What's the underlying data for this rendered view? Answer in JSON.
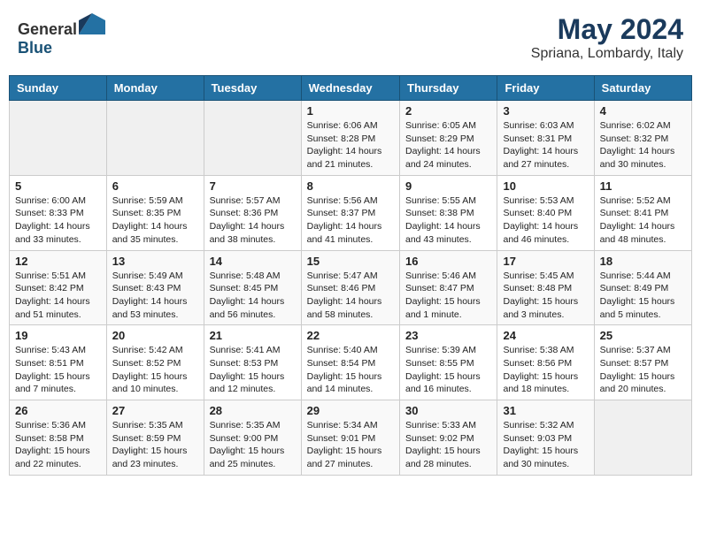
{
  "header": {
    "logo_general": "General",
    "logo_blue": "Blue",
    "month_year": "May 2024",
    "location": "Spriana, Lombardy, Italy"
  },
  "days_of_week": [
    "Sunday",
    "Monday",
    "Tuesday",
    "Wednesday",
    "Thursday",
    "Friday",
    "Saturday"
  ],
  "weeks": [
    {
      "days": [
        {
          "number": "",
          "sunrise": "",
          "sunset": "",
          "daylight": ""
        },
        {
          "number": "",
          "sunrise": "",
          "sunset": "",
          "daylight": ""
        },
        {
          "number": "",
          "sunrise": "",
          "sunset": "",
          "daylight": ""
        },
        {
          "number": "1",
          "sunrise": "Sunrise: 6:06 AM",
          "sunset": "Sunset: 8:28 PM",
          "daylight": "Daylight: 14 hours and 21 minutes."
        },
        {
          "number": "2",
          "sunrise": "Sunrise: 6:05 AM",
          "sunset": "Sunset: 8:29 PM",
          "daylight": "Daylight: 14 hours and 24 minutes."
        },
        {
          "number": "3",
          "sunrise": "Sunrise: 6:03 AM",
          "sunset": "Sunset: 8:31 PM",
          "daylight": "Daylight: 14 hours and 27 minutes."
        },
        {
          "number": "4",
          "sunrise": "Sunrise: 6:02 AM",
          "sunset": "Sunset: 8:32 PM",
          "daylight": "Daylight: 14 hours and 30 minutes."
        }
      ]
    },
    {
      "days": [
        {
          "number": "5",
          "sunrise": "Sunrise: 6:00 AM",
          "sunset": "Sunset: 8:33 PM",
          "daylight": "Daylight: 14 hours and 33 minutes."
        },
        {
          "number": "6",
          "sunrise": "Sunrise: 5:59 AM",
          "sunset": "Sunset: 8:35 PM",
          "daylight": "Daylight: 14 hours and 35 minutes."
        },
        {
          "number": "7",
          "sunrise": "Sunrise: 5:57 AM",
          "sunset": "Sunset: 8:36 PM",
          "daylight": "Daylight: 14 hours and 38 minutes."
        },
        {
          "number": "8",
          "sunrise": "Sunrise: 5:56 AM",
          "sunset": "Sunset: 8:37 PM",
          "daylight": "Daylight: 14 hours and 41 minutes."
        },
        {
          "number": "9",
          "sunrise": "Sunrise: 5:55 AM",
          "sunset": "Sunset: 8:38 PM",
          "daylight": "Daylight: 14 hours and 43 minutes."
        },
        {
          "number": "10",
          "sunrise": "Sunrise: 5:53 AM",
          "sunset": "Sunset: 8:40 PM",
          "daylight": "Daylight: 14 hours and 46 minutes."
        },
        {
          "number": "11",
          "sunrise": "Sunrise: 5:52 AM",
          "sunset": "Sunset: 8:41 PM",
          "daylight": "Daylight: 14 hours and 48 minutes."
        }
      ]
    },
    {
      "days": [
        {
          "number": "12",
          "sunrise": "Sunrise: 5:51 AM",
          "sunset": "Sunset: 8:42 PM",
          "daylight": "Daylight: 14 hours and 51 minutes."
        },
        {
          "number": "13",
          "sunrise": "Sunrise: 5:49 AM",
          "sunset": "Sunset: 8:43 PM",
          "daylight": "Daylight: 14 hours and 53 minutes."
        },
        {
          "number": "14",
          "sunrise": "Sunrise: 5:48 AM",
          "sunset": "Sunset: 8:45 PM",
          "daylight": "Daylight: 14 hours and 56 minutes."
        },
        {
          "number": "15",
          "sunrise": "Sunrise: 5:47 AM",
          "sunset": "Sunset: 8:46 PM",
          "daylight": "Daylight: 14 hours and 58 minutes."
        },
        {
          "number": "16",
          "sunrise": "Sunrise: 5:46 AM",
          "sunset": "Sunset: 8:47 PM",
          "daylight": "Daylight: 15 hours and 1 minute."
        },
        {
          "number": "17",
          "sunrise": "Sunrise: 5:45 AM",
          "sunset": "Sunset: 8:48 PM",
          "daylight": "Daylight: 15 hours and 3 minutes."
        },
        {
          "number": "18",
          "sunrise": "Sunrise: 5:44 AM",
          "sunset": "Sunset: 8:49 PM",
          "daylight": "Daylight: 15 hours and 5 minutes."
        }
      ]
    },
    {
      "days": [
        {
          "number": "19",
          "sunrise": "Sunrise: 5:43 AM",
          "sunset": "Sunset: 8:51 PM",
          "daylight": "Daylight: 15 hours and 7 minutes."
        },
        {
          "number": "20",
          "sunrise": "Sunrise: 5:42 AM",
          "sunset": "Sunset: 8:52 PM",
          "daylight": "Daylight: 15 hours and 10 minutes."
        },
        {
          "number": "21",
          "sunrise": "Sunrise: 5:41 AM",
          "sunset": "Sunset: 8:53 PM",
          "daylight": "Daylight: 15 hours and 12 minutes."
        },
        {
          "number": "22",
          "sunrise": "Sunrise: 5:40 AM",
          "sunset": "Sunset: 8:54 PM",
          "daylight": "Daylight: 15 hours and 14 minutes."
        },
        {
          "number": "23",
          "sunrise": "Sunrise: 5:39 AM",
          "sunset": "Sunset: 8:55 PM",
          "daylight": "Daylight: 15 hours and 16 minutes."
        },
        {
          "number": "24",
          "sunrise": "Sunrise: 5:38 AM",
          "sunset": "Sunset: 8:56 PM",
          "daylight": "Daylight: 15 hours and 18 minutes."
        },
        {
          "number": "25",
          "sunrise": "Sunrise: 5:37 AM",
          "sunset": "Sunset: 8:57 PM",
          "daylight": "Daylight: 15 hours and 20 minutes."
        }
      ]
    },
    {
      "days": [
        {
          "number": "26",
          "sunrise": "Sunrise: 5:36 AM",
          "sunset": "Sunset: 8:58 PM",
          "daylight": "Daylight: 15 hours and 22 minutes."
        },
        {
          "number": "27",
          "sunrise": "Sunrise: 5:35 AM",
          "sunset": "Sunset: 8:59 PM",
          "daylight": "Daylight: 15 hours and 23 minutes."
        },
        {
          "number": "28",
          "sunrise": "Sunrise: 5:35 AM",
          "sunset": "Sunset: 9:00 PM",
          "daylight": "Daylight: 15 hours and 25 minutes."
        },
        {
          "number": "29",
          "sunrise": "Sunrise: 5:34 AM",
          "sunset": "Sunset: 9:01 PM",
          "daylight": "Daylight: 15 hours and 27 minutes."
        },
        {
          "number": "30",
          "sunrise": "Sunrise: 5:33 AM",
          "sunset": "Sunset: 9:02 PM",
          "daylight": "Daylight: 15 hours and 28 minutes."
        },
        {
          "number": "31",
          "sunrise": "Sunrise: 5:32 AM",
          "sunset": "Sunset: 9:03 PM",
          "daylight": "Daylight: 15 hours and 30 minutes."
        },
        {
          "number": "",
          "sunrise": "",
          "sunset": "",
          "daylight": ""
        }
      ]
    }
  ]
}
